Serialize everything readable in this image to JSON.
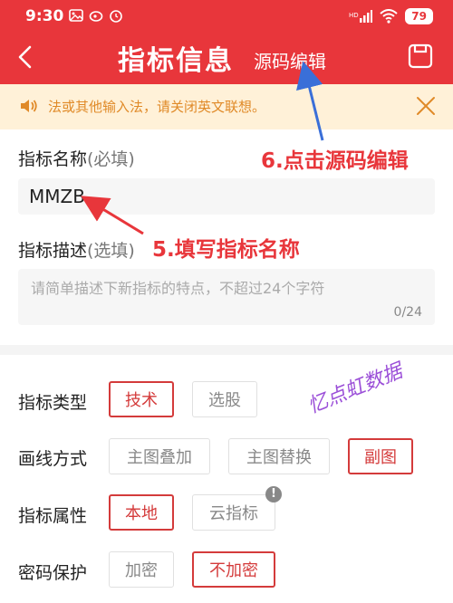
{
  "status_bar": {
    "time": "9:30",
    "battery": "79"
  },
  "header": {
    "title": "指标信息",
    "source_edit_label": "源码编辑"
  },
  "banner": {
    "text": "法或其他输入法，请关闭英文联想。"
  },
  "form": {
    "name_label": "指标名称",
    "name_hint": "(必填)",
    "name_value": "MMZB",
    "desc_label": "指标描述",
    "desc_hint": "(选填)",
    "desc_placeholder": "请简单描述下新指标的特点，不超过24个字符",
    "desc_count": "0/24"
  },
  "options": {
    "type": {
      "label": "指标类型",
      "choices": [
        "技术",
        "选股"
      ],
      "selected": "技术"
    },
    "drawing": {
      "label": "画线方式",
      "choices": [
        "主图叠加",
        "主图替换",
        "副图"
      ],
      "selected": "副图"
    },
    "attribute": {
      "label": "指标属性",
      "choices": [
        "本地",
        "云指标"
      ],
      "selected": "本地",
      "info_badge": "!"
    },
    "password": {
      "label": "密码保护",
      "choices": [
        "加密",
        "不加密"
      ],
      "selected": "不加密"
    }
  },
  "annotations": {
    "step6": "6.点击源码编辑",
    "step5": "5.填写指标名称",
    "watermark": "忆点虹数据"
  },
  "colors": {
    "header_red": "#e8363b",
    "selected_red": "#d43b3b",
    "banner_bg": "#fff1d8",
    "banner_text": "#e08a28"
  }
}
